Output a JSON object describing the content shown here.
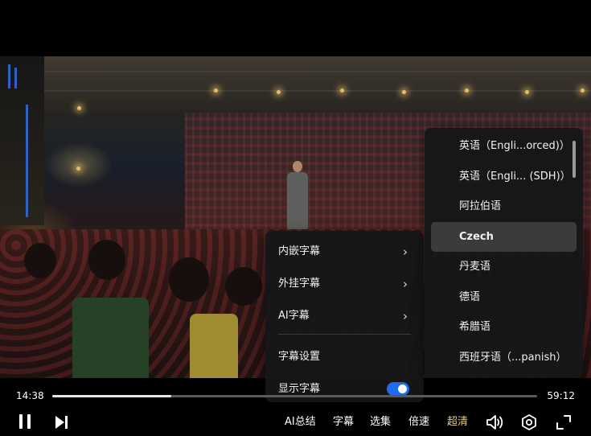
{
  "player": {
    "current_time": "14:38",
    "duration": "59:12",
    "progress": 0.2454
  },
  "subtitle_menu": {
    "embedded_label": "内嵌字幕",
    "external_label": "外挂字幕",
    "ai_label": "AI字幕",
    "settings_label": "字幕设置",
    "show_label": "显示字幕",
    "show_enabled": true
  },
  "language_menu": {
    "items": [
      "英语（Engli...orced)）",
      "英语（Engli... (SDH)）",
      "阿拉伯语",
      "Czech",
      "丹麦语",
      "德语",
      "希腊语",
      "西班牙语（...panish）"
    ],
    "selected_index": 3
  },
  "controls": {
    "ai_summary": "AI总结",
    "subtitle": "字幕",
    "episodes": "选集",
    "speed": "倍速",
    "quality": "超清"
  },
  "icons": {
    "pause": "pause-icon",
    "next": "next-icon",
    "volume": "volume-icon",
    "settings": "settings-icon",
    "fullscreen": "fullscreen-icon",
    "chevron": "chevron-right-icon"
  },
  "colors": {
    "accent": "#1e6bf0",
    "quality": "#f0c776"
  }
}
